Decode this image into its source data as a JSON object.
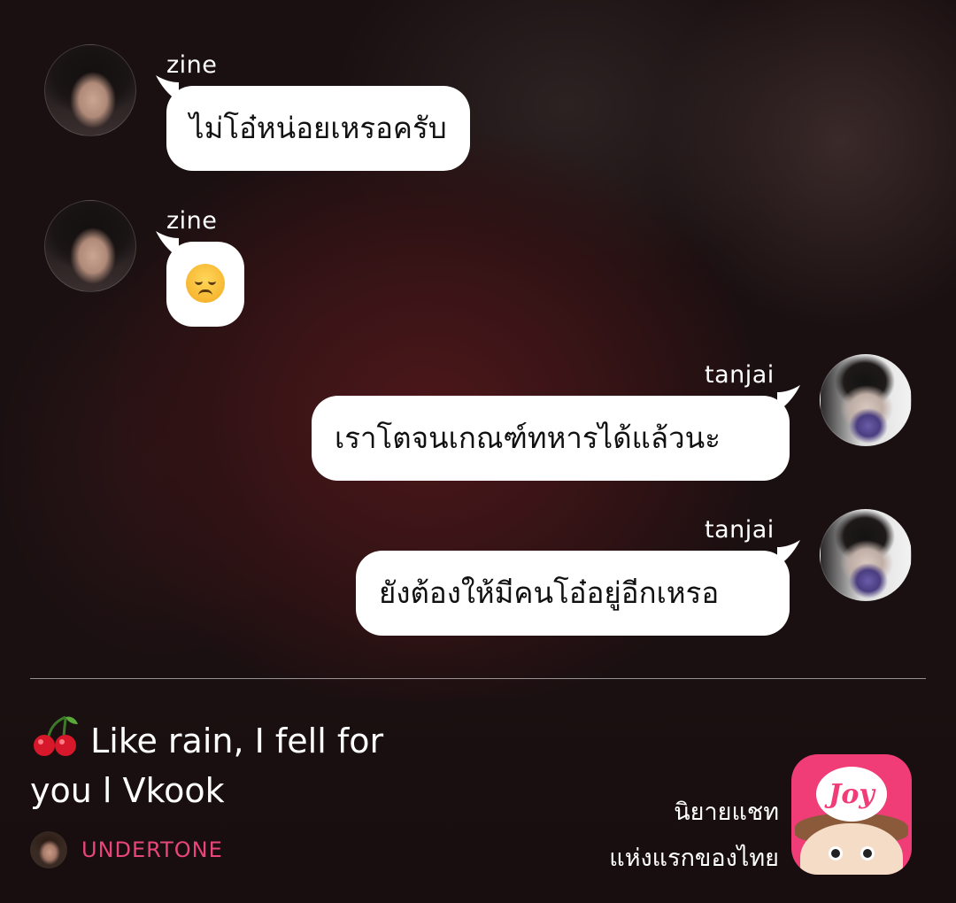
{
  "messages": [
    {
      "sender": "zine",
      "text": "ไม่โอ๋หน่อยเหรอครับ",
      "side": "left"
    },
    {
      "sender": "zine",
      "text": "",
      "emoji": "disappointed-face",
      "side": "left"
    },
    {
      "sender": "tanjai",
      "text": "เราโตจนเกณฑ์ทหารได้แล้วนะ",
      "side": "right"
    },
    {
      "sender": "tanjai",
      "text": "ยังต้องให้มีคนโอ๋อยู่อีกเหรอ",
      "side": "right"
    }
  ],
  "story": {
    "title": "Like rain, I fell for you l Vkook",
    "author": "UNDERTONE"
  },
  "brand": {
    "line1": "นิยายแชท",
    "line2": "แห่งแรกของไทย",
    "logo_text": "Joy"
  },
  "colors": {
    "bubble": "#ffffff",
    "author": "#e8467b",
    "brand_logo": "#f03d78"
  }
}
